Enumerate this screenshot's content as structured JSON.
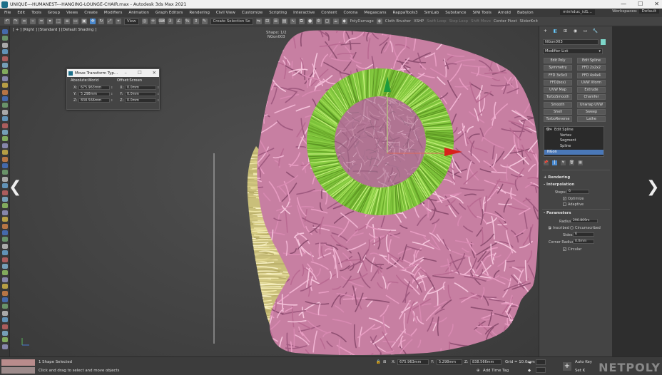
{
  "window": {
    "title": "UNIQUE---HUMANEST---HANGING-LOUNGE-CHAIR.max - Autodesk 3ds Max 2021",
    "controls": [
      "—",
      "☐",
      "✕"
    ]
  },
  "menubar": {
    "items": [
      "File",
      "Edit",
      "Tools",
      "Group",
      "Views",
      "Create",
      "Modifiers",
      "Animation",
      "Graph Editors",
      "Rendering",
      "Civil View",
      "Customize",
      "Scripting",
      "Interactive",
      "Content",
      "Corona",
      "Megascans",
      "RappaTools3",
      "SimLab",
      "Substance",
      "SiNi Tools",
      "Arnold",
      "Babylon"
    ],
    "user": "minhduc_id1...",
    "workspaces_label": "Workspaces:",
    "workspaces_value": "Default"
  },
  "toolbar": {
    "view_select": "View",
    "selection_set": "Create Selection Se",
    "labels": [
      "PolyDamage",
      "Cloth Brusher",
      "XSHP",
      "Swift Loop",
      "Step Loop",
      "Shift Move",
      "Center Pivot",
      "SliderKnit"
    ]
  },
  "viewport": {
    "label": "[ + ] [Right ] [Standard ] [Default Shading ]",
    "shape_info_line1": "Shape: 1/2",
    "shape_info_line2": "NGon003",
    "nav_prev": "❮",
    "nav_next": "❯"
  },
  "move_transform_dialog": {
    "title": "Move Transform Typ...",
    "absolute_label": "Absolute:World",
    "offset_label": "Offset:Screen",
    "absolute": [
      {
        "axis": "X:",
        "value": "675.963mm"
      },
      {
        "axis": "Y:",
        "value": "5.298mm"
      },
      {
        "axis": "Z:",
        "value": "838.566mm"
      }
    ],
    "offset": [
      {
        "axis": "X:",
        "value": "0.0mm"
      },
      {
        "axis": "Y:",
        "value": "0.0mm"
      },
      {
        "axis": "Z:",
        "value": "0.0mm"
      }
    ]
  },
  "command_panel": {
    "object_name": "NGon003",
    "color": "#7dd6c9",
    "modifier_list": "Modifier List",
    "modifier_buttons": [
      "Edit Poly",
      "Edit Spline",
      "Symmetry",
      "FFD 2x2x2",
      "FFD 3x3x3",
      "FFD 4x4x4",
      "FFD(box)",
      "UVW Xform",
      "UVW Map",
      "Extrude",
      "TurboSmooth",
      "Chamfer",
      "Smooth",
      "Unwrap UVW",
      "Shell",
      "Sweep",
      "TurboReverse",
      "Lathe"
    ],
    "stack": {
      "modifier": "Edit Spline",
      "sub": [
        "Vertex",
        "Segment",
        "Spline"
      ],
      "base": "NGon"
    },
    "rendering_rollout": "Rendering",
    "interpolation_rollout": "Interpolation",
    "steps_label": "Steps:",
    "steps_value": "6",
    "optimize_label": "Optimize",
    "adaptive_label": "Adaptive",
    "parameters_rollout": "Parameters",
    "radius_label": "Radius:",
    "radius_value": "290.809m",
    "inscribed_label": "Inscribed",
    "circumscribed_label": "Circumscribed",
    "sides_label": "Sides:",
    "sides_value": "6",
    "corner_radius_label": "Corner Radius:",
    "corner_radius_value": "0.0mm",
    "circular_label": "Circular"
  },
  "statusbar": {
    "selection_status": "1 Shape Selected",
    "prompt": "Click and drag to select and move objects",
    "x_value": "675.963mm",
    "y_value": "5.298mm",
    "z_value": "838.566mm",
    "grid": "Grid = 10.0mm",
    "add_time_tag": "Add Time Tag",
    "auto_key": "Auto Key",
    "set_key": "Set K",
    "watermark": "NETPOLY"
  },
  "colors": {
    "fiber_pink": "#d98ab0",
    "ring_green": "#8fd143",
    "side_yellow": "#d9d08a",
    "gizmo_green": "#1e9b3c",
    "gizmo_red": "#d8221c"
  }
}
